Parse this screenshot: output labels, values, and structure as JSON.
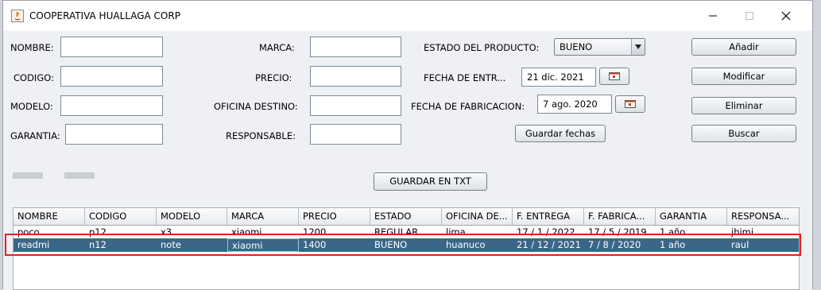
{
  "window": {
    "title": "COOPERATIVA HUALLAGA CORP"
  },
  "form": {
    "nombre_label": "NOMBRE:",
    "codigo_label": "CODIGO:",
    "modelo_label": "MODELO:",
    "garantia_label": "GARANTIA:",
    "marca_label": "MARCA:",
    "precio_label": "PRECIO:",
    "oficina_label": "OFICINA DESTINO:",
    "responsable_label": "RESPONSABLE:",
    "estado_label": "ESTADO DEL PRODUCTO:",
    "estado_value": "BUENO",
    "fecha_entrega_label": "FECHA DE ENTR...",
    "fecha_entrega_value": "21 dic. 2021",
    "fecha_fabricacion_label": "FECHA DE FABRICACION:",
    "fecha_fabricacion_value": "7 ago. 2020",
    "guardar_fechas_label": "Guardar  fechas",
    "guardar_txt_label": "GUARDAR EN TXT"
  },
  "actions": {
    "anadir": "Añadir",
    "modificar": "Modificar",
    "eliminar": "Eliminar",
    "buscar": "Buscar"
  },
  "table": {
    "columns": [
      "NOMBRE",
      "CODIGO",
      "MODELO",
      "MARCA",
      "PRECIO",
      "ESTADO",
      "OFICINA DE...",
      "F. ENTREGA",
      "F. FABRICA...",
      "GARANTIA",
      "RESPONSA..."
    ],
    "rows": [
      [
        "poco",
        "p12",
        "x3",
        "xiaomi",
        "1200",
        "REGULAR",
        "lima",
        "17 / 1 / 2022",
        "17 / 5 / 2019",
        "1 año",
        "jhimi"
      ],
      [
        "readmi",
        "n12",
        "note",
        "xiaomi",
        "1400",
        "BUENO",
        "huanuco",
        "21 / 12 / 2021",
        "7 / 8 / 2020",
        "1 año",
        "raul"
      ]
    ],
    "selected_row": 1
  }
}
